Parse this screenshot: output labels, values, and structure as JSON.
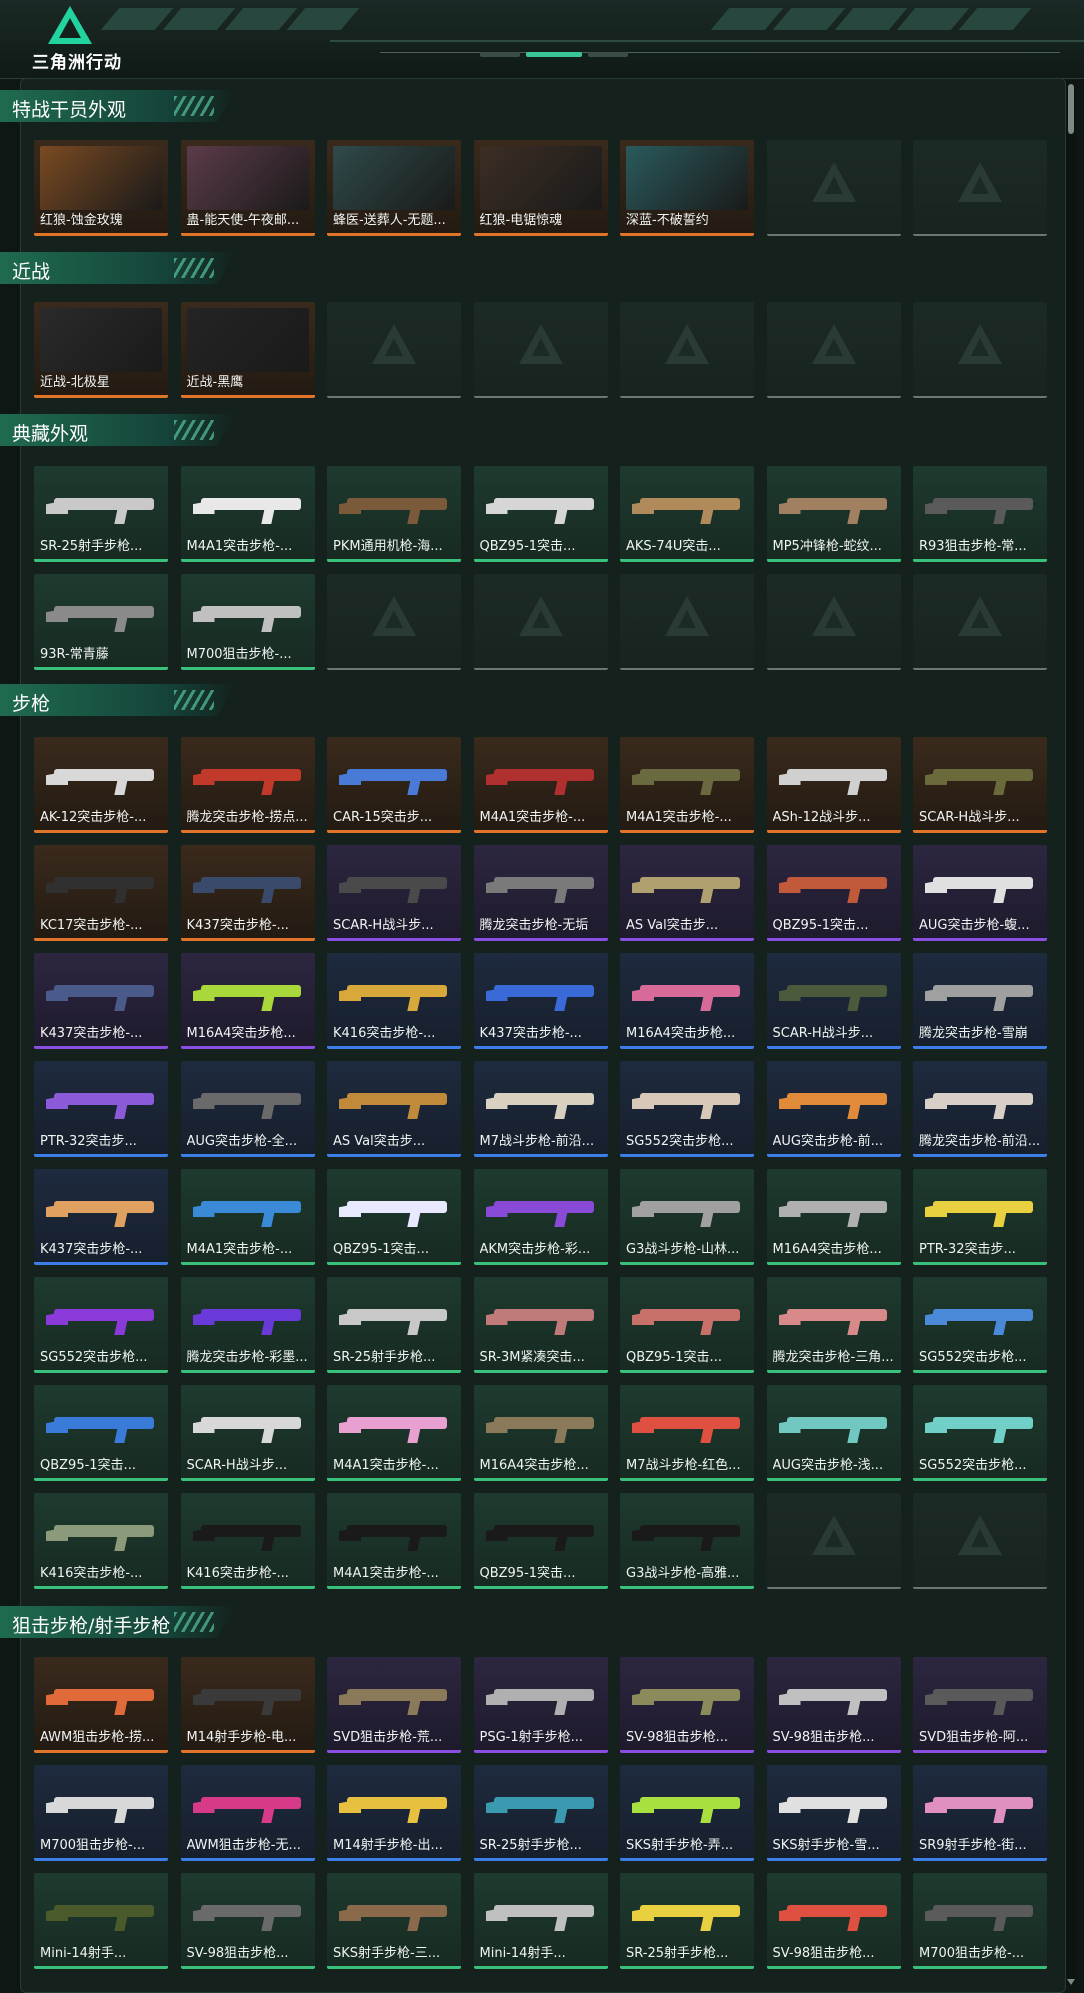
{
  "app": {
    "logo_text": "三角洲行动"
  },
  "sections": [
    {
      "title": "特战干员外观",
      "items": [
        {
          "name": "红狼-蚀金玫瑰",
          "tier": "gold",
          "thumb": "#7a4a22"
        },
        {
          "name": "蛊-能天使-午夜邮...",
          "tier": "gold",
          "thumb": "#5c3b4a"
        },
        {
          "name": "蜂医-送葬人-无题...",
          "tier": "gold",
          "thumb": "#2f4a4a"
        },
        {
          "name": "红狼-电锯惊魂",
          "tier": "gold",
          "thumb": "#3c2e24"
        },
        {
          "name": "深蓝-不破誓约",
          "tier": "gold",
          "thumb": "#2a5a5c"
        },
        {
          "name": "",
          "tier": "empty"
        },
        {
          "name": "",
          "tier": "empty"
        }
      ]
    },
    {
      "title": "近战",
      "items": [
        {
          "name": "近战-北极星",
          "tier": "gold",
          "thumb": "#2a2a2a"
        },
        {
          "name": "近战-黑鹰",
          "tier": "gold",
          "thumb": "#242424"
        },
        {
          "name": "",
          "tier": "empty"
        },
        {
          "name": "",
          "tier": "empty"
        },
        {
          "name": "",
          "tier": "empty"
        },
        {
          "name": "",
          "tier": "empty"
        },
        {
          "name": "",
          "tier": "empty"
        }
      ]
    },
    {
      "title": "典藏外观",
      "items": [
        {
          "name": "SR-25射手步枪...",
          "tier": "green",
          "gun": "#c9c9c9"
        },
        {
          "name": "M4A1突击步枪-...",
          "tier": "green",
          "gun": "#e8e8e8"
        },
        {
          "name": "PKM通用机枪-海...",
          "tier": "green",
          "gun": "#7a5a3a"
        },
        {
          "name": "QBZ95-1突击...",
          "tier": "green",
          "gun": "#d6d6d6"
        },
        {
          "name": "AKS-74U突击...",
          "tier": "green",
          "gun": "#b08a5a"
        },
        {
          "name": "MP5冲锋枪-蛇纹...",
          "tier": "green",
          "gun": "#a08060"
        },
        {
          "name": "R93狙击步枪-常...",
          "tier": "green",
          "gun": "#5a5a5a"
        },
        {
          "name": "93R-常青藤",
          "tier": "green",
          "gun": "#8a8a8a"
        },
        {
          "name": "M700狙击步枪-...",
          "tier": "green",
          "gun": "#c0c0c0"
        },
        {
          "name": "",
          "tier": "empty"
        },
        {
          "name": "",
          "tier": "empty"
        },
        {
          "name": "",
          "tier": "empty"
        },
        {
          "name": "",
          "tier": "empty"
        },
        {
          "name": "",
          "tier": "empty"
        }
      ]
    },
    {
      "title": "步枪",
      "items": [
        {
          "name": "AK-12突击步枪-...",
          "tier": "gold",
          "gun": "#d8d8d8"
        },
        {
          "name": "腾龙突击步枪-捞点...",
          "tier": "gold",
          "gun": "#c0392b"
        },
        {
          "name": "CAR-15突击步...",
          "tier": "gold",
          "gun": "#4a7ad8"
        },
        {
          "name": "M4A1突击步枪-...",
          "tier": "gold",
          "gun": "#b03030"
        },
        {
          "name": "M4A1突击步枪-...",
          "tier": "gold",
          "gun": "#6a6a40"
        },
        {
          "name": "ASh-12战斗步...",
          "tier": "gold",
          "gun": "#d0d0d0"
        },
        {
          "name": "SCAR-H战斗步...",
          "tier": "gold",
          "gun": "#6a6a3a"
        },
        {
          "name": "KC17突击步枪-...",
          "tier": "gold",
          "gun": "#303030"
        },
        {
          "name": "K437突击步枪-...",
          "tier": "gold",
          "gun": "#3a4a6a"
        },
        {
          "name": "SCAR-H战斗步...",
          "tier": "purple",
          "gun": "#4a4a4a"
        },
        {
          "name": "腾龙突击步枪-无垢",
          "tier": "purple",
          "gun": "#7a7a7a"
        },
        {
          "name": "AS Val突击步...",
          "tier": "purple",
          "gun": "#b0a070"
        },
        {
          "name": "QBZ95-1突击...",
          "tier": "purple",
          "gun": "#c05a3a"
        },
        {
          "name": "AUG突击步枪-蝮...",
          "tier": "purple",
          "gun": "#e0e0e0"
        },
        {
          "name": "K437突击步枪-...",
          "tier": "purple",
          "gun": "#4a5a8a"
        },
        {
          "name": "M16A4突击步枪...",
          "tier": "purple",
          "gun": "#a8d83a"
        },
        {
          "name": "K416突击步枪-...",
          "tier": "blue",
          "gun": "#d8a83a"
        },
        {
          "name": "K437突击步枪-...",
          "tier": "blue",
          "gun": "#3a6ad8"
        },
        {
          "name": "M16A4突击步枪...",
          "tier": "blue",
          "gun": "#d86a9a"
        },
        {
          "name": "SCAR-H战斗步...",
          "tier": "blue",
          "gun": "#4a5a3a"
        },
        {
          "name": "腾龙突击步枪-雪崩",
          "tier": "blue",
          "gun": "#a0a0a0"
        },
        {
          "name": "PTR-32突击步...",
          "tier": "blue",
          "gun": "#8a5ad8"
        },
        {
          "name": "AUG突击步枪-全...",
          "tier": "blue",
          "gun": "#6a6a6a"
        },
        {
          "name": "AS Val突击步...",
          "tier": "blue",
          "gun": "#c08a3a"
        },
        {
          "name": "M7战斗步枪-前沿...",
          "tier": "blue",
          "gun": "#d8d0c0"
        },
        {
          "name": "SG552突击步枪...",
          "tier": "blue",
          "gun": "#d8c8b8"
        },
        {
          "name": "AUG突击步枪-前...",
          "tier": "blue",
          "gun": "#e08a3a"
        },
        {
          "name": "腾龙突击步枪-前沿...",
          "tier": "blue",
          "gun": "#d8d0c8"
        },
        {
          "name": "K437突击步枪-...",
          "tier": "blue",
          "gun": "#e0a060"
        },
        {
          "name": "M4A1突击步枪-...",
          "tier": "green",
          "gun": "#3a8ad8"
        },
        {
          "name": "QBZ95-1突击...",
          "tier": "green",
          "gun": "#e8e8ff"
        },
        {
          "name": "AKM突击步枪-彩...",
          "tier": "green",
          "gun": "#8a4ad8"
        },
        {
          "name": "G3战斗步枪-山林...",
          "tier": "green",
          "gun": "#a0a0a0"
        },
        {
          "name": "M16A4突击步枪...",
          "tier": "green",
          "gun": "#b0b0b0"
        },
        {
          "name": "PTR-32突击步...",
          "tier": "green",
          "gun": "#e8d040"
        },
        {
          "name": "SG552突击步枪...",
          "tier": "green",
          "gun": "#8a3ad8"
        },
        {
          "name": "腾龙突击步枪-彩墨...",
          "tier": "green",
          "gun": "#6a3ad8"
        },
        {
          "name": "SR-25射手步枪...",
          "tier": "green",
          "gun": "#c8c8c8"
        },
        {
          "name": "SR-3M紧凑突击...",
          "tier": "green",
          "gun": "#c07a7a"
        },
        {
          "name": "QBZ95-1突击...",
          "tier": "green",
          "gun": "#c8706a"
        },
        {
          "name": "腾龙突击步枪-三角...",
          "tier": "green",
          "gun": "#d88a8a"
        },
        {
          "name": "SG552突击步枪...",
          "tier": "green",
          "gun": "#4a8ad8"
        },
        {
          "name": "QBZ95-1突击...",
          "tier": "green",
          "gun": "#3a7ad8"
        },
        {
          "name": "SCAR-H战斗步...",
          "tier": "green",
          "gun": "#d8d8d8"
        },
        {
          "name": "M4A1突击步枪-...",
          "tier": "green",
          "gun": "#e8a0d0"
        },
        {
          "name": "M16A4突击步枪...",
          "tier": "green",
          "gun": "#8a7a5a"
        },
        {
          "name": "M7战斗步枪-红色...",
          "tier": "green",
          "gun": "#e05040"
        },
        {
          "name": "AUG突击步枪-浅...",
          "tier": "green",
          "gun": "#70c8c0"
        },
        {
          "name": "SG552突击步枪...",
          "tier": "green",
          "gun": "#70d0c8"
        },
        {
          "name": "K416突击步枪-...",
          "tier": "green",
          "gun": "#8a9a7a"
        },
        {
          "name": "K416突击步枪-...",
          "tier": "green",
          "gun": "#1a1a1a"
        },
        {
          "name": "M4A1突击步枪-...",
          "tier": "green",
          "gun": "#1a1a1a"
        },
        {
          "name": "QBZ95-1突击...",
          "tier": "green",
          "gun": "#1a1a1a"
        },
        {
          "name": "G3战斗步枪-高雅...",
          "tier": "green",
          "gun": "#1a1a1a"
        },
        {
          "name": "",
          "tier": "empty"
        },
        {
          "name": "",
          "tier": "empty"
        }
      ]
    },
    {
      "title": "狙击步枪/射手步枪",
      "items": [
        {
          "name": "AWM狙击步枪-捞...",
          "tier": "gold",
          "gun": "#e06a3a"
        },
        {
          "name": "M14射手步枪-电...",
          "tier": "gold",
          "gun": "#3a3a3a"
        },
        {
          "name": "SVD狙击步枪-荒...",
          "tier": "purple",
          "gun": "#8a7a5a"
        },
        {
          "name": "PSG-1射手步枪...",
          "tier": "purple",
          "gun": "#b0b0b0"
        },
        {
          "name": "SV-98狙击步枪...",
          "tier": "purple",
          "gun": "#8a8a5a"
        },
        {
          "name": "SV-98狙击步枪...",
          "tier": "purple",
          "gun": "#c0c0c0"
        },
        {
          "name": "SVD狙击步枪-阿...",
          "tier": "purple",
          "gun": "#5a5a5a"
        },
        {
          "name": "M700狙击步枪-...",
          "tier": "blue",
          "gun": "#d8d8d8"
        },
        {
          "name": "AWM狙击步枪-无...",
          "tier": "blue",
          "gun": "#d83a8a"
        },
        {
          "name": "M14射手步枪-出...",
          "tier": "blue",
          "gun": "#e8c040"
        },
        {
          "name": "SR-25射手步枪...",
          "tier": "blue",
          "gun": "#3a9ab0"
        },
        {
          "name": "SKS射手步枪-弄...",
          "tier": "blue",
          "gun": "#a8e040"
        },
        {
          "name": "SKS射手步枪-雪...",
          "tier": "blue",
          "gun": "#e0e0e0"
        },
        {
          "name": "SR9射手步枪-街...",
          "tier": "blue",
          "gun": "#e090c0"
        },
        {
          "name": "Mini-14射手...",
          "tier": "green",
          "gun": "#4a5a2a"
        },
        {
          "name": "SV-98狙击步枪...",
          "tier": "green",
          "gun": "#6a6a6a"
        },
        {
          "name": "SKS射手步枪-三...",
          "tier": "green",
          "gun": "#8a6a4a"
        },
        {
          "name": "Mini-14射手...",
          "tier": "green",
          "gun": "#c0c0c0"
        },
        {
          "name": "SR-25射手步枪...",
          "tier": "green",
          "gun": "#e8d040"
        },
        {
          "name": "SV-98狙击步枪...",
          "tier": "green",
          "gun": "#e05040"
        },
        {
          "name": "M700狙击步枪-...",
          "tier": "green",
          "gun": "#5a5a5a"
        }
      ]
    }
  ]
}
